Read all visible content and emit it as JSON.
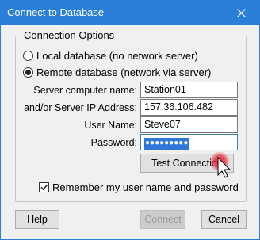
{
  "window": {
    "title": "Connect to Database",
    "colors": {
      "titlebar": "#2b7fd8",
      "selection": "#3078d7",
      "cursor_highlight": "#e0182b"
    }
  },
  "group": {
    "title": "Connection Options",
    "radio_local": {
      "label": "Local database (no network server)",
      "checked": false
    },
    "radio_remote": {
      "label": "Remote database (network via server)",
      "checked": true
    }
  },
  "fields": {
    "server_name": {
      "label": "Server computer name:",
      "value": "Station01"
    },
    "server_ip": {
      "label": "and/or Server IP Address:",
      "value": "157.36.106.482"
    },
    "user_name": {
      "label": "User Name:",
      "value": "Steve07"
    },
    "password": {
      "label": "Password:",
      "value": "●●●●●●●●●",
      "selected": true
    }
  },
  "test_button": {
    "label": "Test Connection"
  },
  "remember": {
    "label": "Remember my user name and password",
    "checked": true
  },
  "footer": {
    "help_label": "Help",
    "connect_label": "Connect",
    "cancel_label": "Cancel"
  },
  "icons": {
    "close": "close-icon",
    "cursor": "mouse-pointer-icon"
  }
}
